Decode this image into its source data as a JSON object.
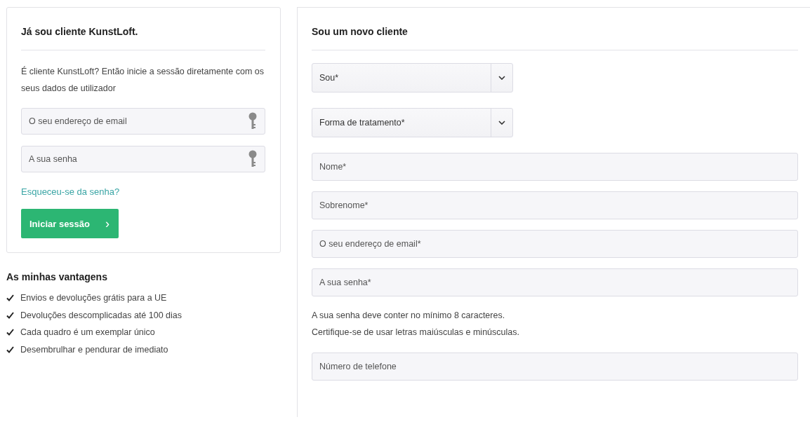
{
  "login": {
    "title": "Já sou cliente KunstLoft.",
    "intro": "É cliente KunstLoft? Então inicie a sessão diretamente com os seus dados de utilizador",
    "fields": [
      {
        "placeholder": "O seu endereço de email"
      },
      {
        "placeholder": "A sua senha"
      }
    ],
    "forgot_link": "Esqueceu-se da senha?",
    "submit": "Iniciar sessão",
    "submit_arrow": "›"
  },
  "advantages": {
    "title": "As minhas vantagens",
    "items": [
      "Envios e devoluções grátis para a UE",
      "Devoluções descomplicadas até 100 dias",
      "Cada quadro é um exemplar único",
      "Desembrulhar e pendurar de imediato"
    ]
  },
  "register": {
    "title": "Sou um novo cliente",
    "fields": [
      {
        "kind": "select",
        "placeholder": "Sou*"
      },
      {
        "kind": "select",
        "placeholder": "Forma de tratamento*"
      },
      {
        "kind": "text",
        "placeholder": "Nome*"
      },
      {
        "kind": "text",
        "placeholder": "Sobrenome*"
      },
      {
        "kind": "text",
        "placeholder": "O seu endereço de email*"
      },
      {
        "kind": "text",
        "placeholder": "A sua senha*"
      },
      {
        "kind": "hint",
        "lines": [
          "A sua senha deve conter no mínimo 8 caracteres.",
          "Certifique-se de usar letras maiúsculas e minúsculas."
        ]
      },
      {
        "kind": "text",
        "placeholder": "Número de telefone"
      }
    ]
  }
}
